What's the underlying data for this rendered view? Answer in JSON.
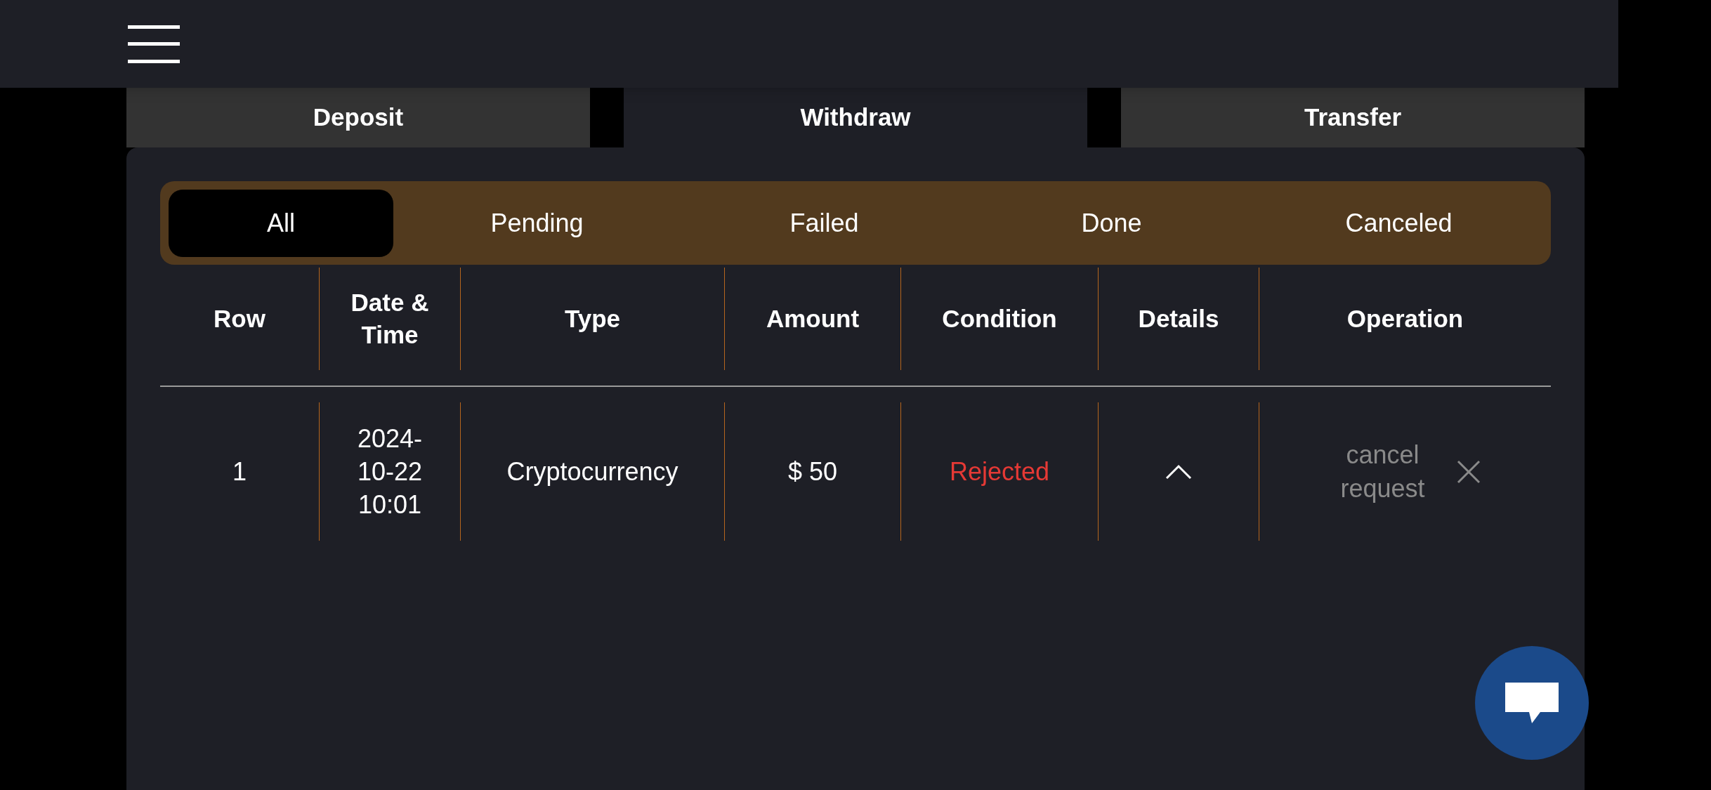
{
  "main_tabs": [
    {
      "label": "Deposit",
      "selected": false
    },
    {
      "label": "Withdraw",
      "selected": true
    },
    {
      "label": "Transfer",
      "selected": false
    }
  ],
  "filters": [
    {
      "label": "All",
      "selected": true
    },
    {
      "label": "Pending",
      "selected": false
    },
    {
      "label": "Failed",
      "selected": false
    },
    {
      "label": "Done",
      "selected": false
    },
    {
      "label": "Canceled",
      "selected": false
    }
  ],
  "table": {
    "columns": [
      "Row",
      "Date & Time",
      "Type",
      "Amount",
      "Condition",
      "Details",
      "Operation"
    ],
    "rows": [
      {
        "row": "1",
        "date_time": "2024-10-22 10:01",
        "type": "Cryptocurrency",
        "amount": "$ 50",
        "condition": {
          "label": "Rejected",
          "color": "#e53935"
        },
        "details": {
          "expanded": true
        },
        "operation": {
          "label": "cancel request"
        }
      }
    ]
  }
}
